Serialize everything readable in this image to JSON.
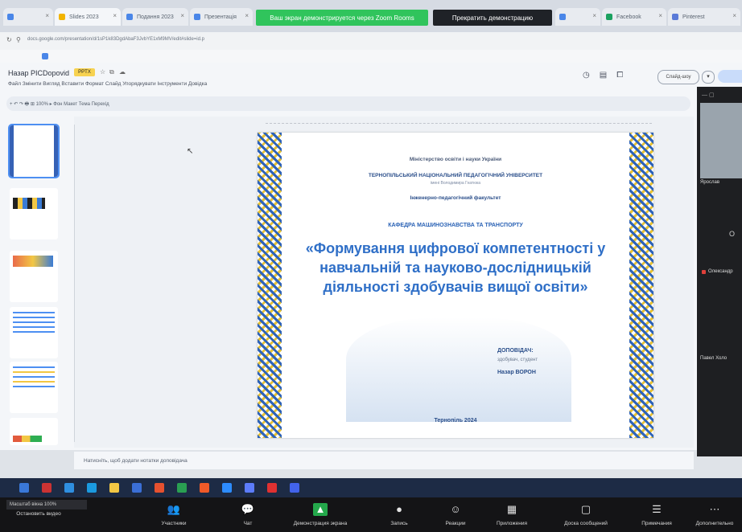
{
  "browser": {
    "tabs": [
      "",
      "Slides 2023",
      "Подання 2023",
      "Презентація",
      "",
      "Facebook",
      "Pinterest"
    ],
    "share_banner": "Ваш экран демонстрируется через Zoom Rooms",
    "stop_button": "Прекратить демонстрацию",
    "address": "docs.google.com/presentation/d/1sP1k83DgdAbaF3JvbYE1xM9MV/edit#slide=id.p"
  },
  "slides_app": {
    "doc_title": "Назар PICDopovid",
    "doc_badge": "PPTX",
    "menu": "Файл   Змінити   Вигляд   Вставити   Формат   Слайд   Упорядкувати   Інструменти   Довідка",
    "toolbar": "+  ↶  ↷  🖶  ⊞  100%  ▸  Фон  Макет  Тема  Перехід",
    "access_button": "Слайд-шоу",
    "notes_placeholder": "Натисніть, щоб додати нотатки доповідача"
  },
  "slide": {
    "line1": "Міністерство освіти і науки України",
    "line2": "ТЕРНОПІЛЬСЬКИЙ НАЦІОНАЛЬНИЙ ПЕДАГОГІЧНИЙ УНІВЕРСИТЕТ",
    "line2b": "імені Володимира Гнатюка",
    "line3": "Інженерно-педагогічний факультет",
    "line4": "КАФЕДРА МАШИНОЗНАВСТВА ТА ТРАНСПОРТУ",
    "title": "«Формування цифрової компетентності у навчальній та науково-дослідницькій діяльності здобувачів вищої освіти»",
    "reporter_label": "ДОПОВІДАЧ:",
    "reporter_role": "здобувач, студент",
    "reporter_name": "Назар ВОРОН",
    "city": "Тернопіль 2024"
  },
  "zoom_panel": {
    "name1": "Ярослав",
    "o_letter": "О",
    "name2": "Олександр",
    "name3": "Павел Холо"
  },
  "zoom_controls": {
    "chip": "Масштаб вікна 100%",
    "items": [
      {
        "label": "Остановить видео",
        "icon": "▭"
      },
      {
        "label": "Участники",
        "icon": "👥"
      },
      {
        "label": "Чат",
        "icon": "💬"
      },
      {
        "label": "Демонстрация экрана",
        "icon": "▲"
      },
      {
        "label": "Запись",
        "icon": "●"
      },
      {
        "label": "Реакции",
        "icon": "☺"
      },
      {
        "label": "Приложения",
        "icon": "▦"
      },
      {
        "label": "Доска сообщений",
        "icon": "▢"
      },
      {
        "label": "Примечания",
        "icon": "☰"
      },
      {
        "label": "Дополнительно",
        "icon": "⋯"
      }
    ]
  },
  "colors": {
    "slide_blue": "#2f6fc7",
    "border_blue": "#2e63b8",
    "border_yellow": "#e8c234",
    "zoom_green": "#24a84b"
  }
}
